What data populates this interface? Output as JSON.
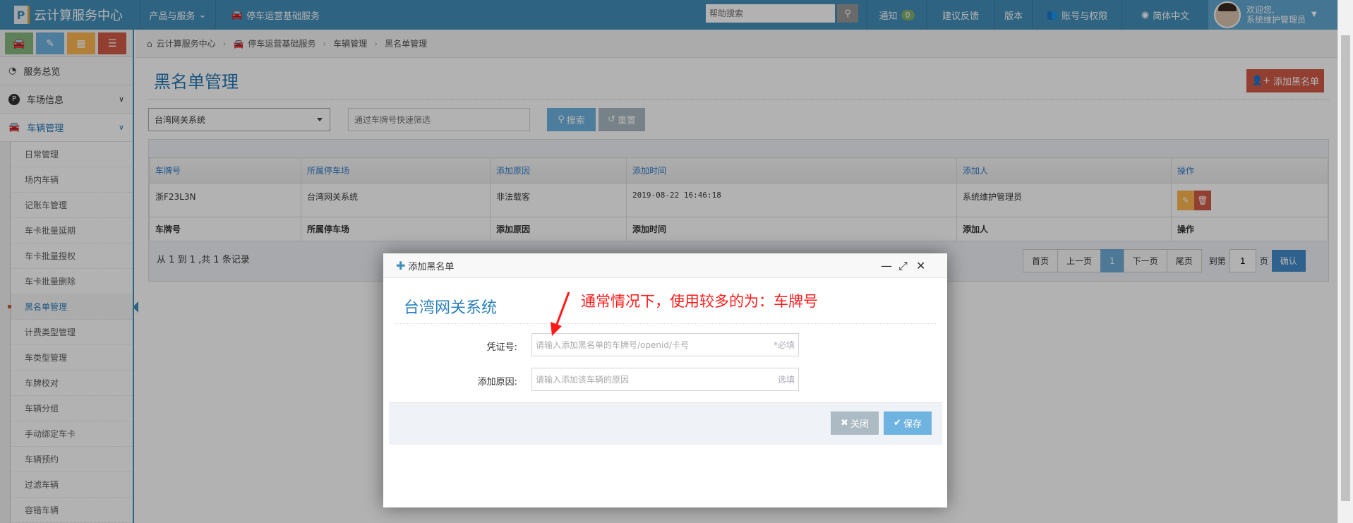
{
  "header": {
    "app_title": "云计算服务中心",
    "nav": [
      "产品与服务",
      "停车运营基础服务"
    ],
    "search_placeholder": "帮助搜索",
    "notify_label": "通知",
    "notify_count": "0",
    "feedback": "建议反馈",
    "version": "版本",
    "account": "账号与权限",
    "language": "简体中文",
    "welcome": "欢迎您,",
    "username": "系统维护管理员"
  },
  "sidebar": {
    "shortcut_colors": [
      "#87b87f",
      "#6fb3e0",
      "#ffb752",
      "#d15b47"
    ],
    "items": [
      {
        "label": "服务总览",
        "icon": "dashboard-icon"
      },
      {
        "label": "车场信息",
        "icon": "parking-icon"
      },
      {
        "label": "车辆管理",
        "icon": "car-icon"
      }
    ],
    "sub_items": [
      "日常管理",
      "场内车辆",
      "记账车管理",
      "车卡批量延期",
      "车卡批量授权",
      "车卡批量删除",
      "黑名单管理",
      "计费类型管理",
      "车类型管理",
      "车牌校对",
      "车辆分组",
      "手动绑定车卡",
      "车辆预约",
      "过滤车辆",
      "容错车辆"
    ],
    "active": "黑名单管理"
  },
  "breadcrumb": [
    "云计算服务中心",
    "停车运营基础服务",
    "车辆管理",
    "黑名单管理"
  ],
  "page": {
    "title": "黑名单管理",
    "add_button": "添加黑名单",
    "park_select": "台湾网关系统",
    "plate_placeholder": "通过车牌号快速筛选",
    "search_button": "搜索",
    "reset_button": "重置"
  },
  "table": {
    "columns": [
      "车牌号",
      "所属停车场",
      "添加原因",
      "添加时间",
      "添加人",
      "操作"
    ],
    "rows": [
      [
        "浙F23L3N",
        "台湾网关系统",
        "非法载客",
        "2019-08-22 16:46:18",
        "系统维护管理员"
      ]
    ]
  },
  "pagination": {
    "records": "从 1 到 1 ,共 1 条记录",
    "first": "首页",
    "prev": "上一页",
    "current": "1",
    "next": "下一页",
    "last": "尾页",
    "goto_prefix": "到第",
    "goto_value": "1",
    "goto_suffix": "页",
    "confirm": "确认"
  },
  "modal": {
    "title": "添加黑名单",
    "park_name": "台湾网关系统",
    "voucher_label": "凭证号:",
    "voucher_placeholder": "请输入添加黑名单的车牌号/openid/卡号",
    "voucher_hint": "*必填",
    "reason_label": "添加原因:",
    "reason_placeholder": "请输入添加该车辆的原因",
    "reason_hint": "选填",
    "close_button": "关闭",
    "save_button": "保存"
  },
  "annotation": "通常情况下，使用较多的为：车牌号"
}
